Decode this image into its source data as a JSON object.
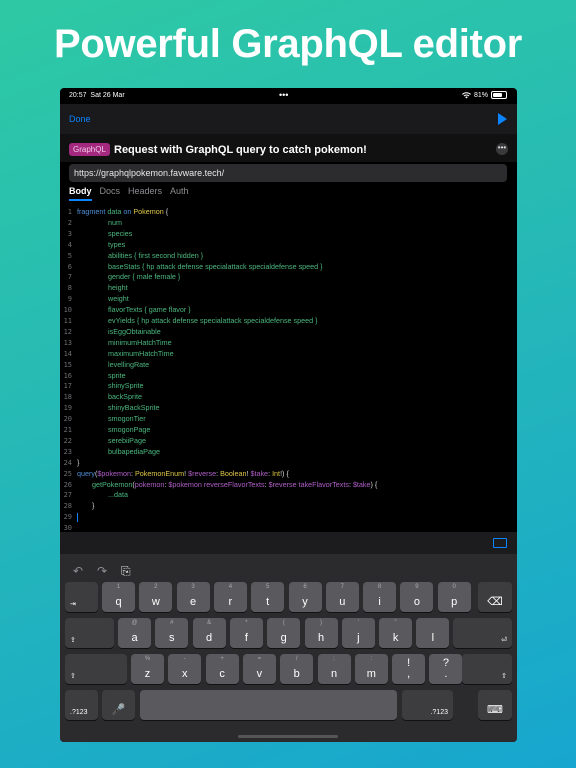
{
  "headline": "Powerful GraphQL editor",
  "status": {
    "time": "20:57",
    "date": "Sat 26 Mar",
    "dots": "•••",
    "battery": "81%"
  },
  "navbar": {
    "done": "Done"
  },
  "request": {
    "tag": "GraphQL",
    "title": "Request with GraphQL query to catch pokemon!",
    "more": "•••",
    "url": "https://graphqlpokemon.favware.tech/"
  },
  "tabs": [
    "Body",
    "Docs",
    "Headers",
    "Auth"
  ],
  "editor": {
    "lines": [
      [
        [
          "fragment ",
          "kw"
        ],
        [
          "data ",
          "fld"
        ],
        [
          "on ",
          "kw"
        ],
        [
          "Pokemon",
          "ty"
        ],
        [
          " {",
          "arg"
        ]
      ],
      [
        [
          "num",
          "fld"
        ]
      ],
      [
        [
          "species",
          "fld"
        ]
      ],
      [
        [
          "types",
          "fld"
        ]
      ],
      [
        [
          "abilities { first second hidden }",
          "fld"
        ]
      ],
      [
        [
          "baseStats { hp attack defense specialattack specialdefense speed }",
          "fld"
        ]
      ],
      [
        [
          "gender { male female }",
          "fld"
        ]
      ],
      [
        [
          "height",
          "fld"
        ]
      ],
      [
        [
          "weight",
          "fld"
        ]
      ],
      [
        [
          "flavorTexts { game flavor }",
          "fld"
        ]
      ],
      [
        [
          "evYields { hp attack defense specialattack specialdefense speed }",
          "fld"
        ]
      ],
      [
        [
          "isEggObtainable",
          "fld"
        ]
      ],
      [
        [
          "minimumHatchTime",
          "fld"
        ]
      ],
      [
        [
          "maximumHatchTime",
          "fld"
        ]
      ],
      [
        [
          "levellingRate",
          "fld"
        ]
      ],
      [
        [
          "sprite",
          "fld"
        ]
      ],
      [
        [
          "shinySprite",
          "fld"
        ]
      ],
      [
        [
          "backSprite",
          "fld"
        ]
      ],
      [
        [
          "shinyBackSprite",
          "fld"
        ]
      ],
      [
        [
          "smogonTier",
          "fld"
        ]
      ],
      [
        [
          "smogonPage",
          "fld"
        ]
      ],
      [
        [
          "serebiiPage",
          "fld"
        ]
      ],
      [
        [
          "bulbapediaPage",
          "fld"
        ]
      ],
      [
        [
          "}",
          "arg"
        ]
      ],
      [
        [
          "query",
          "kw"
        ],
        [
          "(",
          "arg"
        ],
        [
          "$pokemon",
          "var"
        ],
        [
          ": ",
          "arg"
        ],
        [
          "PokemonEnum",
          "ty"
        ],
        [
          "! ",
          "arg"
        ],
        [
          "$reverse",
          "var"
        ],
        [
          ": ",
          "arg"
        ],
        [
          "Boolean",
          "ty"
        ],
        [
          "! ",
          "arg"
        ],
        [
          "$take",
          "var"
        ],
        [
          ": ",
          "arg"
        ],
        [
          "Int",
          "ty"
        ],
        [
          "!) {",
          "arg"
        ]
      ],
      [
        [
          "getPokemon",
          "fld"
        ],
        [
          "(",
          "arg"
        ],
        [
          "pokemon",
          "var"
        ],
        [
          ": ",
          "arg"
        ],
        [
          "$pokemon ",
          "var"
        ],
        [
          "reverseFlavorTexts",
          "var"
        ],
        [
          ": ",
          "arg"
        ],
        [
          "$reverse ",
          "var"
        ],
        [
          "takeFlavorTexts",
          "var"
        ],
        [
          ": ",
          "arg"
        ],
        [
          "$take",
          "var"
        ],
        [
          ") {",
          "arg"
        ]
      ],
      [
        [
          "...data",
          "fld"
        ]
      ],
      [
        [
          "}",
          "arg"
        ]
      ],
      [
        [
          "",
          "arg"
        ]
      ],
      [
        [
          "",
          "arg"
        ]
      ]
    ],
    "indents": [
      0,
      2,
      2,
      2,
      2,
      2,
      2,
      2,
      2,
      2,
      2,
      2,
      2,
      2,
      2,
      2,
      2,
      2,
      2,
      2,
      2,
      2,
      2,
      0,
      0,
      1,
      2,
      1,
      0,
      0
    ]
  },
  "keyboard": {
    "row1": [
      {
        "hint": "1",
        "key": "q"
      },
      {
        "hint": "2",
        "key": "w"
      },
      {
        "hint": "3",
        "key": "e"
      },
      {
        "hint": "4",
        "key": "r"
      },
      {
        "hint": "5",
        "key": "t"
      },
      {
        "hint": "6",
        "key": "y"
      },
      {
        "hint": "7",
        "key": "u"
      },
      {
        "hint": "8",
        "key": "i"
      },
      {
        "hint": "9",
        "key": "o"
      },
      {
        "hint": "0",
        "key": "p"
      }
    ],
    "row2": [
      {
        "hint": "@",
        "key": "a"
      },
      {
        "hint": "#",
        "key": "s"
      },
      {
        "hint": "&",
        "key": "d"
      },
      {
        "hint": "*",
        "key": "f"
      },
      {
        "hint": "(",
        "key": "g"
      },
      {
        "hint": ")",
        "key": "h"
      },
      {
        "hint": "'",
        "key": "j"
      },
      {
        "hint": "\"",
        "key": "k"
      },
      {
        "hint": "",
        "key": "l"
      }
    ],
    "row3": [
      {
        "hint": "%",
        "key": "z"
      },
      {
        "hint": "-",
        "key": "x"
      },
      {
        "hint": "+",
        "key": "c"
      },
      {
        "hint": "=",
        "key": "v"
      },
      {
        "hint": "/",
        "key": "b"
      },
      {
        "hint": ";",
        "key": "n"
      },
      {
        "hint": ":",
        "key": "m"
      },
      {
        "hint": "!",
        "key": ","
      },
      {
        "hint": "?",
        "key": "."
      }
    ],
    "num_label": ".?123",
    "tab_icon": "tab-icon",
    "delete_icon": "delete-icon",
    "shift_icon": "shift-icon",
    "return_icon": "return-icon"
  }
}
